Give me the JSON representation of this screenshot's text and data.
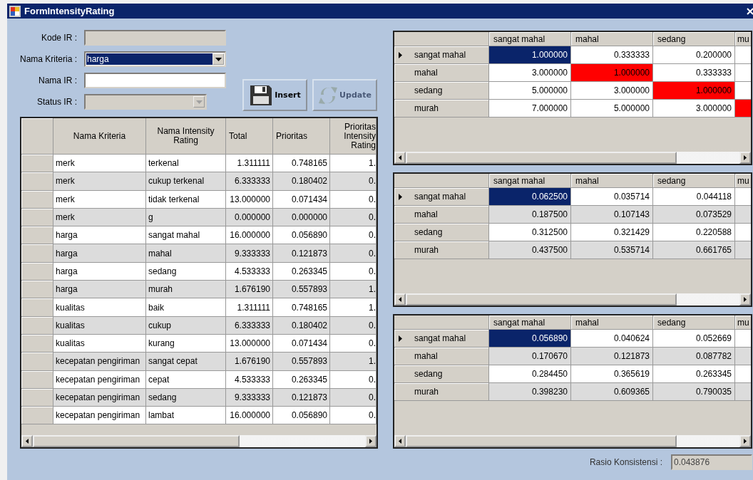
{
  "window": {
    "title": "FormIntensityRating"
  },
  "fields": [
    {
      "label": "Kode IR :",
      "kind": "text",
      "disabled": true
    },
    {
      "label": "Nama Kriteria :",
      "kind": "combo",
      "value": "harga",
      "disabled": false,
      "focused": true
    },
    {
      "label": "Nama IR :",
      "kind": "text",
      "disabled": false
    },
    {
      "label": "Status IR :",
      "kind": "combo",
      "disabled": true
    }
  ],
  "buttons": [
    {
      "label": "Insert",
      "kind": "save",
      "disabled": false
    },
    {
      "label": "Update",
      "kind": "refresh",
      "disabled": true
    }
  ],
  "ratings_table": {
    "columns": [
      "Nama Kriteria",
      "Nama Intensity Rating",
      "Total",
      "Prioritas",
      "Prioritas Intensity Rating"
    ],
    "rows": [
      [
        "merk",
        "terkenal",
        "1.311111",
        "0.748165",
        "1."
      ],
      [
        "merk",
        "cukup terkenal",
        "6.333333",
        "0.180402",
        "0."
      ],
      [
        "merk",
        "tidak terkenal",
        "13.000000",
        "0.071434",
        "0."
      ],
      [
        "merk",
        "g",
        "0.000000",
        "0.000000",
        "0."
      ],
      [
        "harga",
        "sangat mahal",
        "16.000000",
        "0.056890",
        "0."
      ],
      [
        "harga",
        "mahal",
        "9.333333",
        "0.121873",
        "0."
      ],
      [
        "harga",
        "sedang",
        "4.533333",
        "0.263345",
        "0."
      ],
      [
        "harga",
        "murah",
        "1.676190",
        "0.557893",
        "1."
      ],
      [
        "kualitas",
        "baik",
        "1.311111",
        "0.748165",
        "1."
      ],
      [
        "kualitas",
        "cukup",
        "6.333333",
        "0.180402",
        "0."
      ],
      [
        "kualitas",
        "kurang",
        "13.000000",
        "0.071434",
        "0."
      ],
      [
        "kecepatan pengiriman",
        "sangat cepat",
        "1.676190",
        "0.557893",
        "1."
      ],
      [
        "kecepatan pengiriman",
        "cepat",
        "4.533333",
        "0.263345",
        "0."
      ],
      [
        "kecepatan pengiriman",
        "sedang",
        "9.333333",
        "0.121873",
        "0."
      ],
      [
        "kecepatan pengiriman",
        "lambat",
        "16.000000",
        "0.056890",
        "0."
      ]
    ]
  },
  "matrices": [
    {
      "columns": [
        "sangat mahal",
        "mahal",
        "sedang",
        "mu"
      ],
      "alternating": false,
      "rows": [
        {
          "label": "sangat mahal",
          "current": true,
          "clipped_highlight": false,
          "cells": [
            {
              "value": "1.000000",
              "selected": true,
              "highlight": false
            },
            {
              "value": "0.333333",
              "selected": false,
              "highlight": false
            },
            {
              "value": "0.200000",
              "selected": false,
              "highlight": false
            }
          ]
        },
        {
          "label": "mahal",
          "current": false,
          "clipped_highlight": false,
          "cells": [
            {
              "value": "3.000000",
              "selected": false,
              "highlight": false
            },
            {
              "value": "1.000000",
              "selected": false,
              "highlight": true
            },
            {
              "value": "0.333333",
              "selected": false,
              "highlight": false
            }
          ]
        },
        {
          "label": "sedang",
          "current": false,
          "clipped_highlight": false,
          "cells": [
            {
              "value": "5.000000",
              "selected": false,
              "highlight": false
            },
            {
              "value": "3.000000",
              "selected": false,
              "highlight": false
            },
            {
              "value": "1.000000",
              "selected": false,
              "highlight": true
            }
          ]
        },
        {
          "label": "murah",
          "current": false,
          "clipped_highlight": true,
          "cells": [
            {
              "value": "7.000000",
              "selected": false,
              "highlight": false
            },
            {
              "value": "5.000000",
              "selected": false,
              "highlight": false
            },
            {
              "value": "3.000000",
              "selected": false,
              "highlight": false
            }
          ]
        }
      ]
    },
    {
      "columns": [
        "sangat mahal",
        "mahal",
        "sedang",
        "mu"
      ],
      "alternating": true,
      "rows": [
        {
          "label": "sangat mahal",
          "current": true,
          "clipped_highlight": false,
          "cells": [
            {
              "value": "0.062500",
              "selected": true,
              "highlight": false
            },
            {
              "value": "0.035714",
              "selected": false,
              "highlight": false
            },
            {
              "value": "0.044118",
              "selected": false,
              "highlight": false
            }
          ]
        },
        {
          "label": "mahal",
          "current": false,
          "clipped_highlight": false,
          "cells": [
            {
              "value": "0.187500",
              "selected": false,
              "highlight": false
            },
            {
              "value": "0.107143",
              "selected": false,
              "highlight": false
            },
            {
              "value": "0.073529",
              "selected": false,
              "highlight": false
            }
          ]
        },
        {
          "label": "sedang",
          "current": false,
          "clipped_highlight": false,
          "cells": [
            {
              "value": "0.312500",
              "selected": false,
              "highlight": false
            },
            {
              "value": "0.321429",
              "selected": false,
              "highlight": false
            },
            {
              "value": "0.220588",
              "selected": false,
              "highlight": false
            }
          ]
        },
        {
          "label": "murah",
          "current": false,
          "clipped_highlight": false,
          "cells": [
            {
              "value": "0.437500",
              "selected": false,
              "highlight": false
            },
            {
              "value": "0.535714",
              "selected": false,
              "highlight": false
            },
            {
              "value": "0.661765",
              "selected": false,
              "highlight": false
            }
          ]
        }
      ]
    },
    {
      "columns": [
        "sangat mahal",
        "mahal",
        "sedang",
        "mu"
      ],
      "alternating": true,
      "rows": [
        {
          "label": "sangat mahal",
          "current": true,
          "clipped_highlight": false,
          "cells": [
            {
              "value": "0.056890",
              "selected": true,
              "highlight": false
            },
            {
              "value": "0.040624",
              "selected": false,
              "highlight": false
            },
            {
              "value": "0.052669",
              "selected": false,
              "highlight": false
            }
          ]
        },
        {
          "label": "mahal",
          "current": false,
          "clipped_highlight": false,
          "cells": [
            {
              "value": "0.170670",
              "selected": false,
              "highlight": false
            },
            {
              "value": "0.121873",
              "selected": false,
              "highlight": false
            },
            {
              "value": "0.087782",
              "selected": false,
              "highlight": false
            }
          ]
        },
        {
          "label": "sedang",
          "current": false,
          "clipped_highlight": false,
          "cells": [
            {
              "value": "0.284450",
              "selected": false,
              "highlight": false
            },
            {
              "value": "0.365619",
              "selected": false,
              "highlight": false
            },
            {
              "value": "0.263345",
              "selected": false,
              "highlight": false
            }
          ]
        },
        {
          "label": "murah",
          "current": false,
          "clipped_highlight": false,
          "cells": [
            {
              "value": "0.398230",
              "selected": false,
              "highlight": false
            },
            {
              "value": "0.609365",
              "selected": false,
              "highlight": false
            },
            {
              "value": "0.790035",
              "selected": false,
              "highlight": false
            }
          ]
        }
      ]
    }
  ],
  "consistency": {
    "label": "Rasio Konsistensi :",
    "value": "0.043876"
  }
}
